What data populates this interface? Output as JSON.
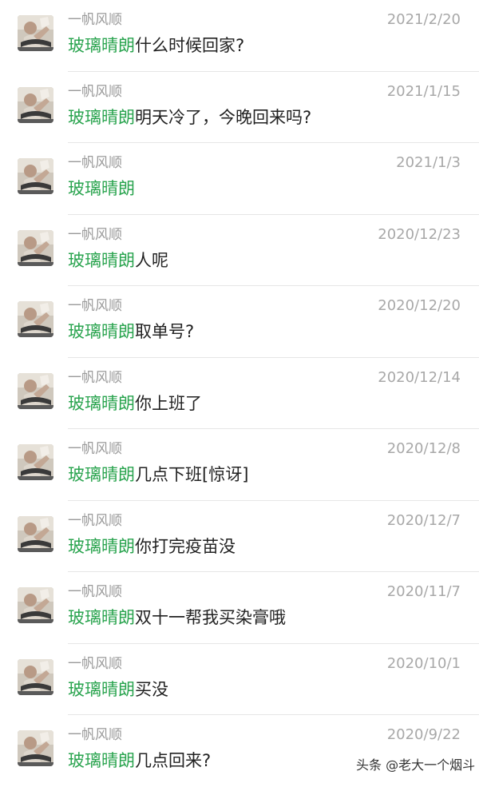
{
  "keyword": "玻璃晴朗",
  "results": [
    {
      "sender": "一帆风顺",
      "date": "2021/2/20",
      "text": "什么时候回家?"
    },
    {
      "sender": "一帆风顺",
      "date": "2021/1/15",
      "text": "明天冷了，今晚回来吗?"
    },
    {
      "sender": "一帆风顺",
      "date": "2021/1/3",
      "text": ""
    },
    {
      "sender": "一帆风顺",
      "date": "2020/12/23",
      "text": "人呢"
    },
    {
      "sender": "一帆风顺",
      "date": "2020/12/20",
      "text": "取单号?"
    },
    {
      "sender": "一帆风顺",
      "date": "2020/12/14",
      "text": "你上班了"
    },
    {
      "sender": "一帆风顺",
      "date": "2020/12/8",
      "text": "几点下班[惊讶]"
    },
    {
      "sender": "一帆风顺",
      "date": "2020/12/7",
      "text": "你打完疫苗没"
    },
    {
      "sender": "一帆风顺",
      "date": "2020/11/7",
      "text": "双十一帮我买染膏哦"
    },
    {
      "sender": "一帆风顺",
      "date": "2020/10/1",
      "text": "买没"
    },
    {
      "sender": "一帆风顺",
      "date": "2020/9/22",
      "text": "几点回来?"
    }
  ],
  "watermark": "头条 @老大一个烟斗",
  "colors": {
    "keyword": "#2aa44f",
    "sender": "#9a9a9a",
    "date": "#a8a8a8",
    "divider": "#e6e6e6"
  }
}
